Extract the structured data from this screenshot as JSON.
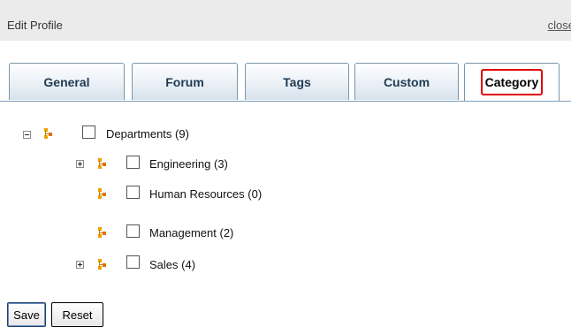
{
  "header": {
    "title": "Edit Profile",
    "close_label": "close"
  },
  "tabs": [
    {
      "label": "General"
    },
    {
      "label": "Forum"
    },
    {
      "label": "Tags"
    },
    {
      "label": "Custom"
    },
    {
      "label": "Category",
      "active": true
    }
  ],
  "tree": {
    "root": {
      "label": "Departments (9)",
      "checked": false,
      "expanded": true
    },
    "children": [
      {
        "label": "Engineering (3)",
        "checked": false,
        "has_children": true,
        "expanded": false
      },
      {
        "label": "Human Resources (0)",
        "checked": false,
        "has_children": false
      },
      {
        "label": "Management (2)",
        "checked": false,
        "has_children": false
      },
      {
        "label": "Sales (4)",
        "checked": false,
        "has_children": true,
        "expanded": false
      }
    ]
  },
  "buttons": {
    "save_label": "Save",
    "reset_label": "Reset"
  },
  "colors": {
    "header_bg": "#ebebeb",
    "tab_border": "#7a96a8",
    "active_highlight": "#e00000",
    "node_icon": "#f0a000"
  }
}
